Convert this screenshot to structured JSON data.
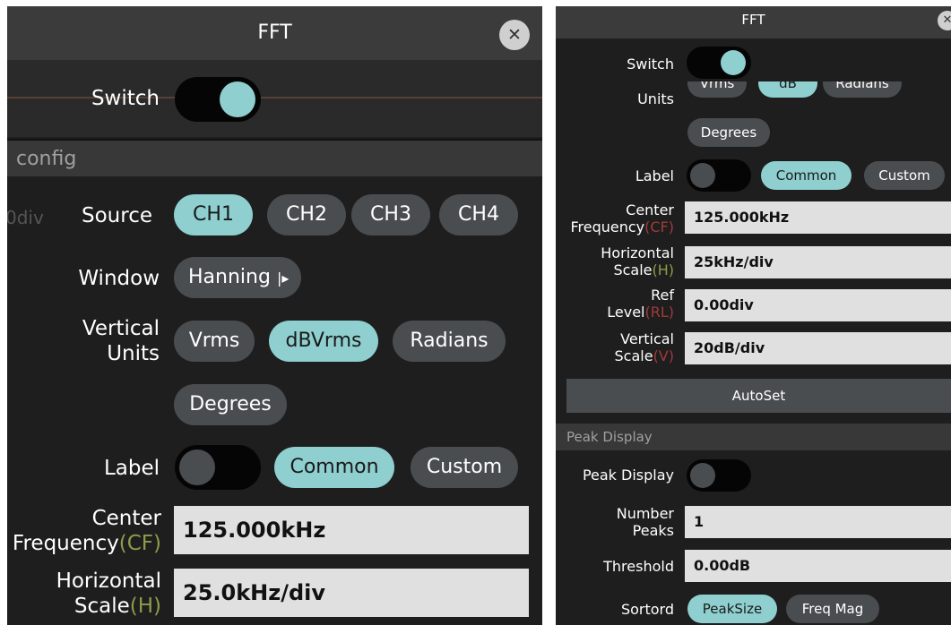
{
  "left_panel": {
    "title": "FFT",
    "close_icon": "✕",
    "switch_label": "Switch",
    "section_config": "config",
    "bg_scale_text": "0div",
    "source_label": "Source",
    "sources": [
      "CH1",
      "CH2",
      "CH3",
      "CH4"
    ],
    "window_label": "Window",
    "window_value": "Hanning",
    "window_arrow": "|▸",
    "vertical_units_label_1": "Vertical",
    "vertical_units_label_2": "Units",
    "units": [
      "Vrms",
      "dBVrms",
      "Radians",
      "Degrees"
    ],
    "label_label": "Label",
    "label_options": [
      "Common",
      "Custom"
    ],
    "cf_label_1": "Center",
    "cf_label_2": "Frequency",
    "cf_abbr": "(CF)",
    "cf_value": "125.000kHz",
    "hs_label_1": "Horizontal",
    "hs_label_2": "Scale",
    "hs_abbr": "(H)",
    "hs_value": "25.0kHz/div"
  },
  "right_panel": {
    "title": "FFT",
    "close_icon": "✕",
    "switch_label": "Switch",
    "units_label": "Units",
    "units_partial": [
      "Vrms",
      "dB",
      "Radians"
    ],
    "units_degrees": "Degrees",
    "label_label": "Label",
    "label_options": [
      "Common",
      "Custom"
    ],
    "cf_label_1": "Center",
    "cf_label_2": "Frequency",
    "cf_abbr": "(CF)",
    "cf_value": "125.000kHz",
    "hs_label_1": "Horizontal",
    "hs_label_2": "Scale",
    "hs_abbr": "(H)",
    "hs_value": "25kHz/div",
    "rl_label_1": "Ref",
    "rl_label_2": "Level",
    "rl_abbr": "(RL)",
    "rl_value": "0.00div",
    "vs_label_1": "Vertical",
    "vs_label_2": "Scale",
    "vs_abbr": "(V)",
    "vs_value": "20dB/div",
    "autoset": "AutoSet",
    "section_peak": "Peak Display",
    "peak_display_label": "Peak Display",
    "number_peaks_label_1": "Number",
    "number_peaks_label_2": "Peaks",
    "number_peaks_value": "1",
    "threshold_label": "Threshold",
    "threshold_value": "0.00dB",
    "sortord_label": "Sortord",
    "sort_options": [
      "PeakSize",
      "Freq Mag"
    ]
  },
  "colors": {
    "accent": "#8fcfcf",
    "panel_bg": "#1e1e1e",
    "pill_bg": "#4a4d50",
    "field_bg": "#e0e0e0"
  }
}
